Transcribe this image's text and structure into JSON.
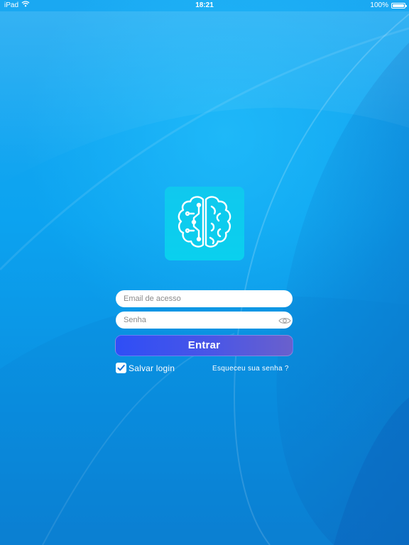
{
  "status_bar": {
    "device": "iPad",
    "time": "18:21",
    "battery_text": "100%",
    "battery_level": 1.0,
    "wifi_icon": "wifi-icon",
    "battery_icon": "battery-icon"
  },
  "logo": {
    "icon": "brain-circuit-icon",
    "background_color": "#10c8ee"
  },
  "login_form": {
    "email_placeholder": "Email de acesso",
    "email_value": "",
    "password_placeholder": "Senha",
    "password_value": "",
    "password_toggle_icon": "eye-icon",
    "submit_label": "Entrar",
    "save_login_label": "Salvar login",
    "save_login_checked": true,
    "forgot_password_label": "Esqueceu sua senha ?"
  },
  "colors": {
    "background": "#0aa2f0",
    "button_start": "#2f4ef6",
    "button_end": "#6a60cc",
    "text": "#ffffff"
  }
}
